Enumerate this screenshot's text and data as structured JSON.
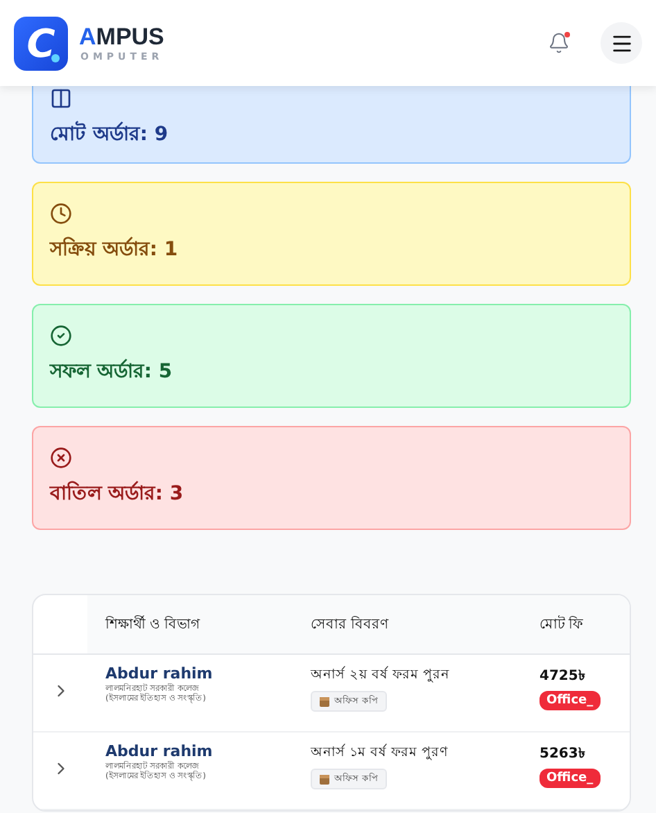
{
  "header": {
    "logo_letter": "C",
    "brand_initial": "A",
    "brand_rest": "MPUS",
    "brand_sub": "OMPUTER",
    "notification_dot": true
  },
  "stats": [
    {
      "kind": "total",
      "label": "মোট অর্ডার: 9"
    },
    {
      "kind": "active",
      "label": "সক্রিয় অর্ডার: 1"
    },
    {
      "kind": "success",
      "label": "সফল অর্ডার: 5"
    },
    {
      "kind": "cancelled",
      "label": "বাতিল অর্ডার: 3"
    }
  ],
  "table": {
    "columns": [
      "শিক্ষার্থী ও বিভাগ",
      "সেবার বিবরণ",
      "মোট ফি"
    ],
    "rows": [
      {
        "name": "Abdur rahim",
        "college": "লালমনিরহাট সরকারী কলেজ",
        "department": "(ইসলামের ইতিহাস ও সংস্কৃতি)",
        "service": "অনার্স ২য় বর্ষ ফরম পুরন",
        "copy": "অফিস কপি",
        "fee": "4725৳",
        "status": "Office_"
      },
      {
        "name": "Abdur rahim",
        "college": "লালমনিরহাট সরকারী কলেজ",
        "department": "(ইসলামের ইতিহাস ও সংস্কৃতি)",
        "service": "অনার্স ১ম বর্ষ ফরম পুরণ",
        "copy": "অফিস কপি",
        "fee": "5263৳",
        "status": "Office_"
      }
    ]
  }
}
